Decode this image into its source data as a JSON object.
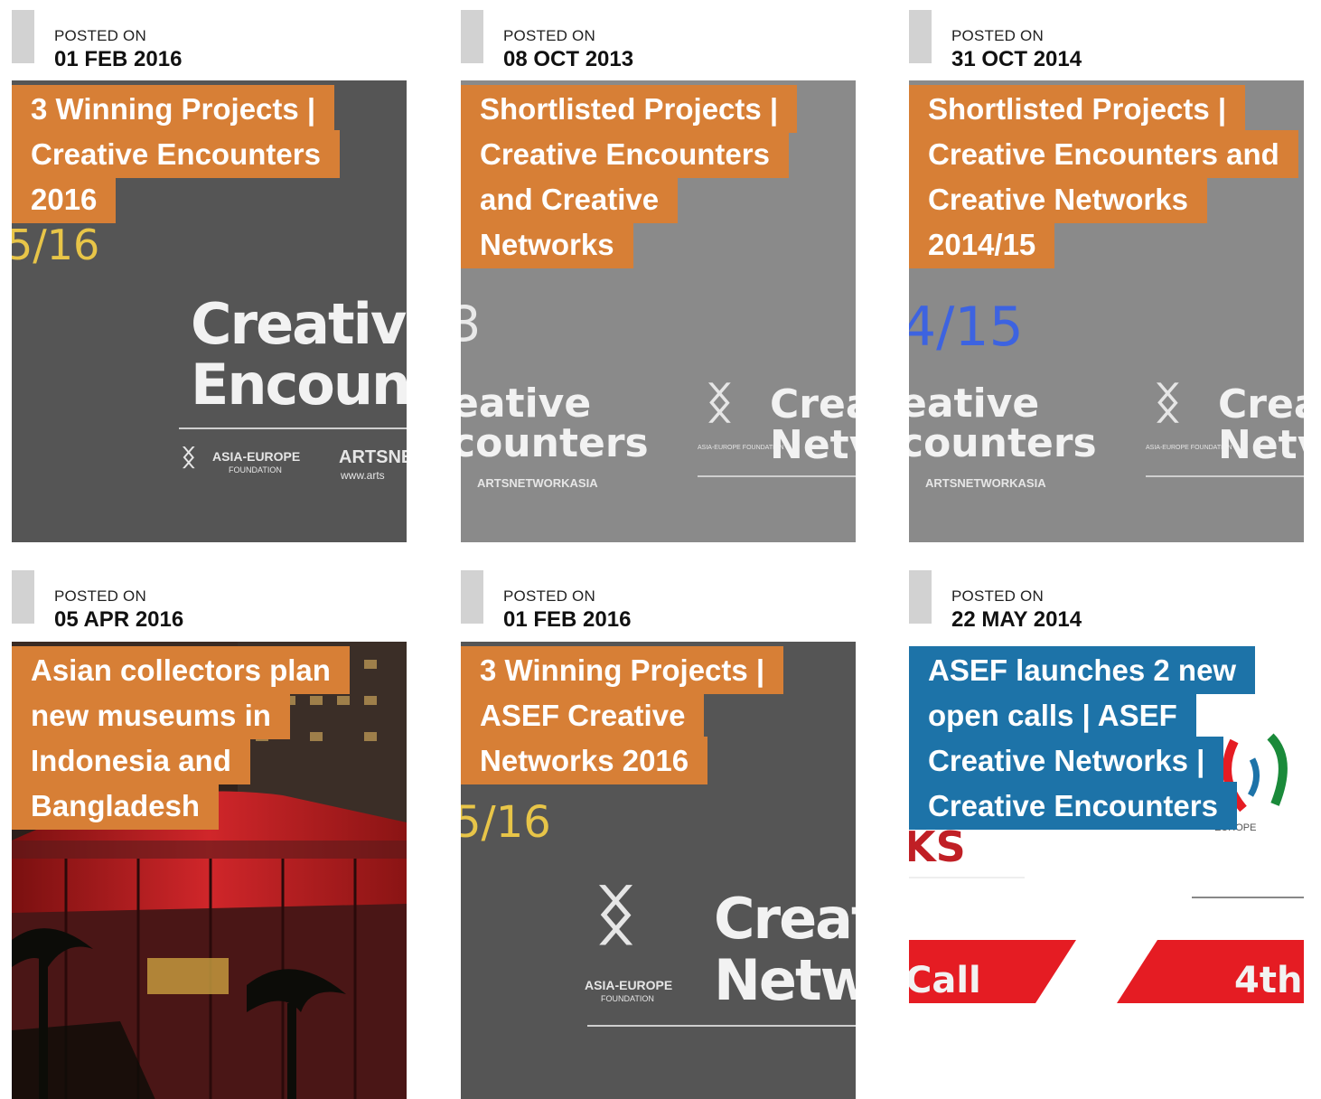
{
  "posts": [
    {
      "posted_label": "POSTED ON",
      "date": "01 FEB 2016",
      "title": "3 Winning Projects | Creative Encounters 2016",
      "title_color": "#d77f36",
      "art": {
        "year_frag": "5/16",
        "line1": "Creative",
        "line2": "Encount",
        "logo": "ASIA-EUROPE",
        "logo_sub": "FOUNDATION",
        "partner": "ARTSNE",
        "partner_url": "www.arts"
      }
    },
    {
      "posted_label": "POSTED ON",
      "date": "08 OCT 2013",
      "title": "Shortlisted Projects | Creative Encounters and Creative Networks",
      "title_color": "#d77f36",
      "art": {
        "year_frag": "3",
        "line1": "eative",
        "line2": "counters",
        "partner": "ARTSNETWORKASIA",
        "logo_sub": "ASIA-EUROPE FOUNDATION",
        "right1": "Crea",
        "right2": "Netv"
      }
    },
    {
      "posted_label": "POSTED ON",
      "date": "31 OCT 2014",
      "title": "Shortlisted Projects | Creative Encounters and Creative Networks 2014/15",
      "title_color": "#d77f36",
      "art": {
        "year_frag": "4/15",
        "line1": "eative",
        "line2": "counters",
        "partner": "ARTSNETWORKASIA",
        "logo_sub": "ASIA-EUROPE FOUNDATION",
        "right1": "Crea",
        "right2": "Netv"
      }
    },
    {
      "posted_label": "POSTED ON",
      "date": "05 APR 2016",
      "title": "Asian collectors plan new museums in Indonesia and Bangladesh",
      "title_color": "#d77f36",
      "art": {}
    },
    {
      "posted_label": "POSTED ON",
      "date": "01 FEB 2016",
      "title": "3 Winning Projects | ASEF Creative Networks 2016",
      "title_color": "#d77f36",
      "art": {
        "year_frag": "5/16",
        "line1": "Creat",
        "line2": "Netw",
        "logo": "ASIA-EUROPE",
        "logo_sub": "FOUNDATION"
      }
    },
    {
      "posted_label": "POSTED ON",
      "date": "22 MAY 2014",
      "title": "ASEF launches 2 new open calls | ASEF Creative Networks | Creative Encounters",
      "title_color": "#1d73a8",
      "art": {
        "frag1": "KS",
        "frag2": "Call",
        "frag3": "4th",
        "logo_sub": "EUROPE"
      }
    }
  ]
}
